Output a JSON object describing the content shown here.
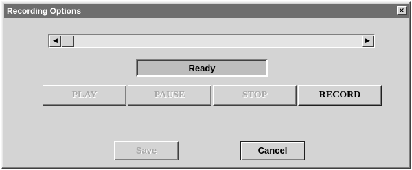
{
  "window": {
    "title": "Recording Options",
    "close_glyph": "×"
  },
  "scrollbar": {
    "left_arrow": "◀",
    "right_arrow": "▶",
    "position_fraction": 0.0
  },
  "status": {
    "text": "Ready"
  },
  "controls": {
    "play": {
      "label": "PLAY",
      "enabled": false
    },
    "pause": {
      "label": "PAUSE",
      "enabled": false
    },
    "stop": {
      "label": "STOP",
      "enabled": false
    },
    "record": {
      "label": "RECORD",
      "enabled": true
    }
  },
  "footer": {
    "save": {
      "label": "Save",
      "enabled": false
    },
    "cancel": {
      "label": "Cancel",
      "enabled": true
    }
  }
}
